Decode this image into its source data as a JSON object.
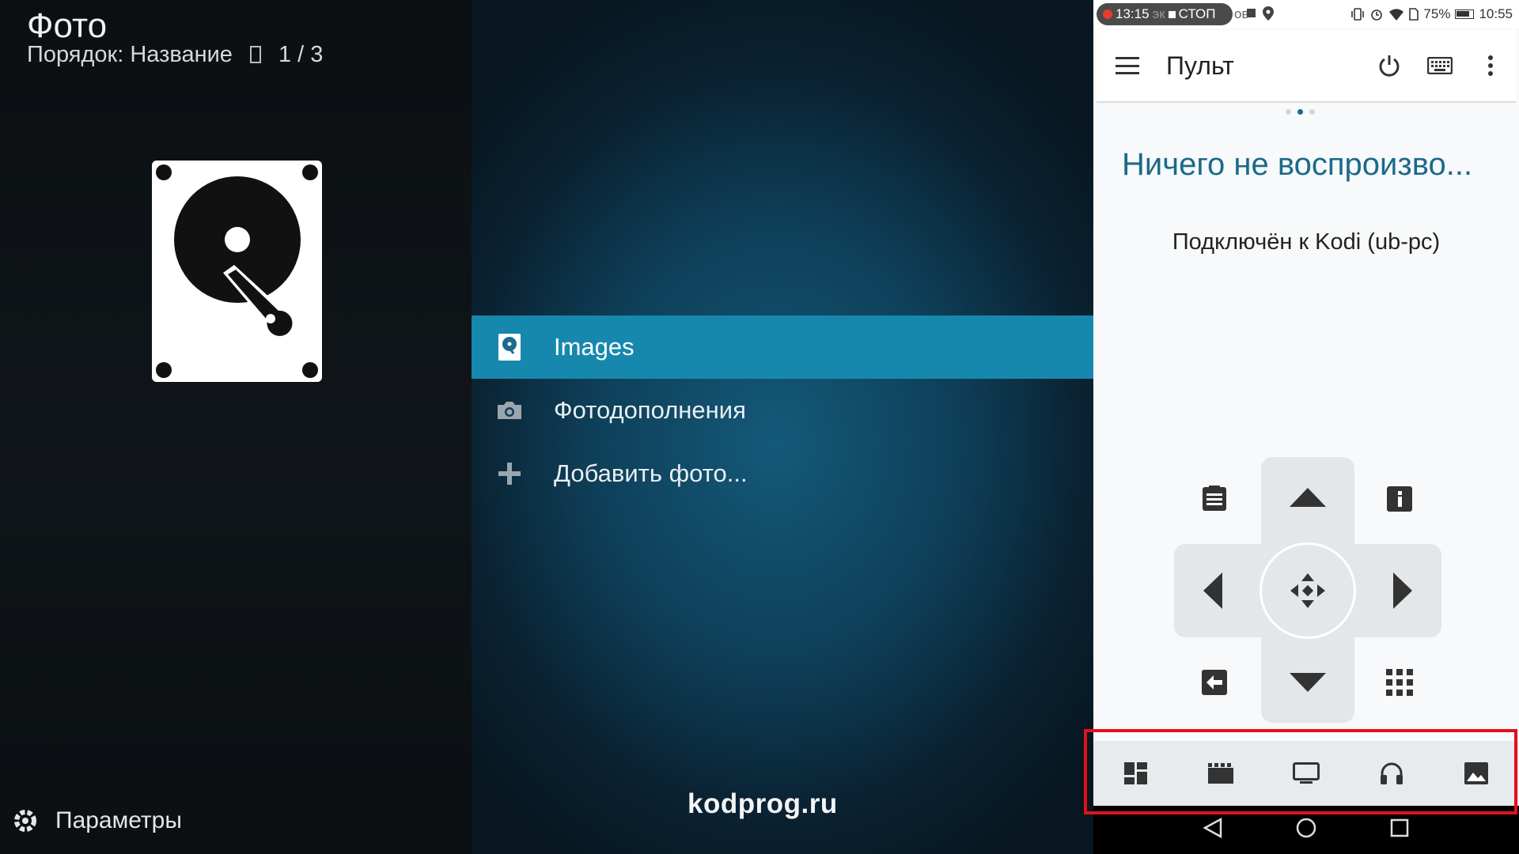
{
  "kodi": {
    "title": "Фото",
    "sort_label": "Порядок: Название",
    "page_counter": "1 / 3",
    "items": [
      {
        "label": "Images",
        "icon": "drive-icon",
        "selected": true
      },
      {
        "label": "Фотодополнения",
        "icon": "camera-icon",
        "selected": false
      },
      {
        "label": "Добавить фото...",
        "icon": "plus-icon",
        "selected": false
      }
    ],
    "settings_label": "Параметры",
    "watermark": "kodprog.ru"
  },
  "phone": {
    "status": {
      "time_left": "13:15",
      "stop_label": "СТОП",
      "obscured_text": "эк",
      "obscured_text2": "ов",
      "battery": "75%",
      "time_right": "10:55"
    },
    "appbar": {
      "title": "Пульт"
    },
    "now_playing": "Ничего не воспроизво...",
    "connection": "Подключён к Kodi (ub-pc)",
    "colors": {
      "accent": "#1b6a8a",
      "kodi_highlight": "#1688ad",
      "annotation": "#e3101a"
    },
    "page_indicator": {
      "count": 3,
      "active": 1
    }
  }
}
